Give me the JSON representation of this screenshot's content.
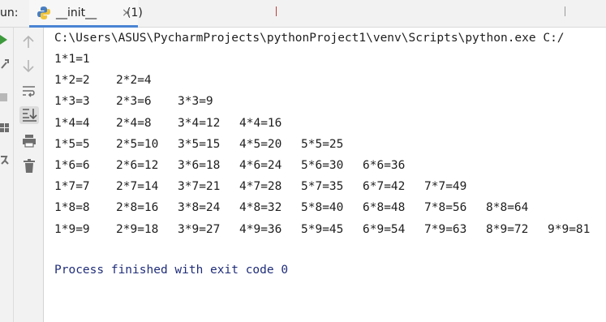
{
  "run_tab": {
    "run_label": "un:",
    "tab_label": "__init__",
    "tab_count": "(1)",
    "close_glyph": "×"
  },
  "toolbar_icons": [
    "rerun-icon",
    "wrench-icon",
    "stop-icon",
    "layout-icon",
    "pin-icon",
    "up-arrow-icon",
    "down-arrow-icon",
    "soft-wrap-icon",
    "scroll-to-end-icon",
    "print-icon",
    "trash-icon"
  ],
  "console": {
    "command": "C:\\Users\\ASUS\\PycharmProjects\\pythonProject1\\venv\\Scripts\\python.exe C:/",
    "rows": [
      [
        "1*1=1"
      ],
      [
        "1*2=2",
        "2*2=4"
      ],
      [
        "1*3=3",
        "2*3=6",
        "3*3=9"
      ],
      [
        "1*4=4",
        "2*4=8",
        "3*4=12",
        "4*4=16"
      ],
      [
        "1*5=5",
        "2*5=10",
        "3*5=15",
        "4*5=20",
        "5*5=25"
      ],
      [
        "1*6=6",
        "2*6=12",
        "3*6=18",
        "4*6=24",
        "5*6=30",
        "6*6=36"
      ],
      [
        "1*7=7",
        "2*7=14",
        "3*7=21",
        "4*7=28",
        "5*7=35",
        "6*7=42",
        "7*7=49"
      ],
      [
        "1*8=8",
        "2*8=16",
        "3*8=24",
        "4*8=32",
        "5*8=40",
        "6*8=48",
        "7*8=56",
        "8*8=64"
      ],
      [
        "1*9=9",
        "2*9=18",
        "3*9=27",
        "4*9=36",
        "5*9=45",
        "6*9=54",
        "7*9=63",
        "8*9=72",
        "9*9=81"
      ]
    ],
    "exit_message": "Process finished with exit code 0"
  },
  "colors": {
    "accent": "#4a84d4",
    "run_green": "#3c9a3c",
    "exit_text": "#1f2d7a"
  }
}
